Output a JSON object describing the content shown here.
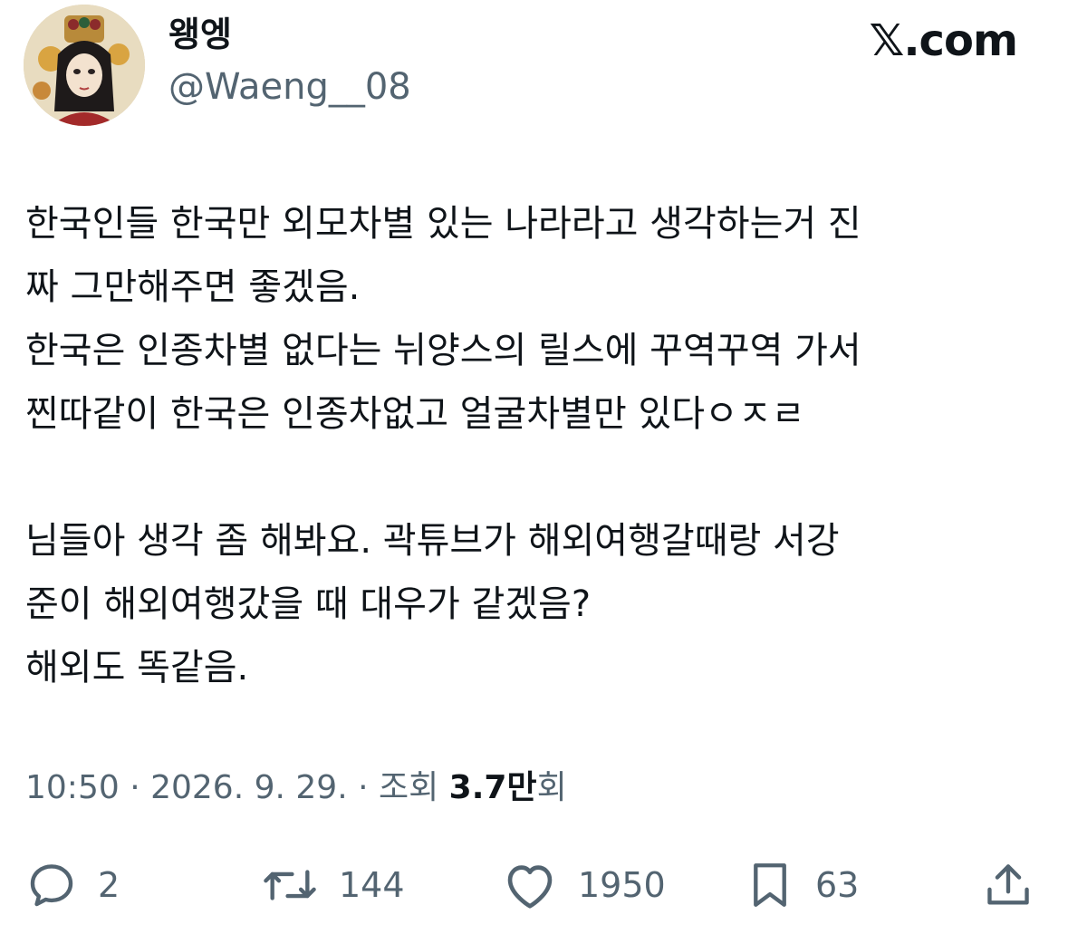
{
  "author": {
    "display_name": "왱엥",
    "handle": "@Waeng__08",
    "avatar_icon": "avatar-image"
  },
  "site_label": "𝕏.com",
  "tweet": {
    "lines": [
      "한국인들 한국만 외모차별 있는 나라라고 생각하는거 진",
      "짜 그만해주면 좋겠음.",
      "한국은 인종차별 없다는 뉘양스의 릴스에 꾸역꾸역 가서",
      "찐따같이 한국은 인종차없고 얼굴차별만 있다ㅇㅈㄹ",
      "",
      "님들아 생각 좀 해봐요. 곽튜브가 해외여행갈때랑 서강",
      "준이 해외여행갔을 때 대우가 같겠음?",
      "해외도 똑같음."
    ]
  },
  "meta": {
    "time": "10:50",
    "separator1": " · ",
    "date": "2026. 9. 29.",
    "separator2": " · ",
    "views_label": "조회 ",
    "views_number": "3.7만",
    "views_suffix": "회"
  },
  "actions": {
    "reply": {
      "icon": "reply-icon",
      "count": "2"
    },
    "retweet": {
      "icon": "retweet-icon",
      "count": "144"
    },
    "like": {
      "icon": "heart-icon",
      "count": "1950"
    },
    "bookmark": {
      "icon": "bookmark-icon",
      "count": "63"
    },
    "share": {
      "icon": "share-icon"
    }
  },
  "colors": {
    "text_primary": "#0f1419",
    "text_secondary": "#536471"
  }
}
